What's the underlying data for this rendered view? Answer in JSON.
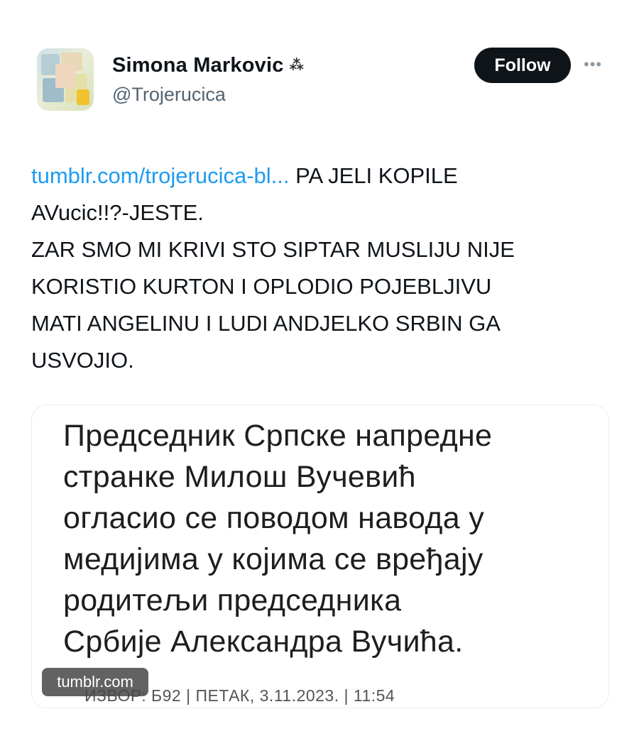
{
  "author": {
    "name": "Simona Markovic",
    "badge_icon": "three-dots-cluster-icon",
    "handle": "@Trojerucica"
  },
  "actions": {
    "follow_label": "Follow",
    "more_icon": "more-options-icon"
  },
  "tweet": {
    "link_text": "tumblr.com/trojerucica-bl...",
    "lines": [
      " PA JELI KOPILE",
      "AVucic!!?-JESTE.",
      "ZAR SMO MI KRIVI STO SIPTAR MUSLIJU NIJE",
      "KORISTIO KURTON I OPLODIO POJEBLJIVU",
      "MATI ANGELINU I LUDI ANDJELKO SRBIN GA",
      "USVOJIO."
    ]
  },
  "media": {
    "lines": [
      "Председник Српске напредне",
      "странке Милош Вучевић",
      "огласио се поводом навода у",
      "медијима у којима се вређају",
      "родитељи председника",
      "Србије Александра Вучића."
    ],
    "source": "ИЗВОР: Б92 | ПЕТАК, 3.11.2023. | 11:54",
    "domain": "tumblr.com"
  },
  "colors": {
    "link": "#1d9bf0",
    "follow_bg": "#0f1419",
    "handle": "#536471"
  }
}
